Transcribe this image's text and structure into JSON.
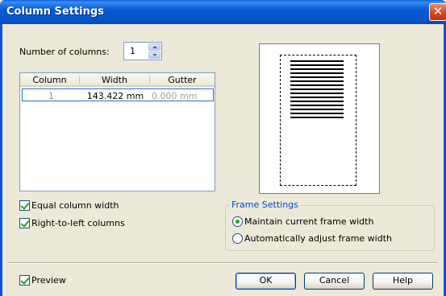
{
  "window": {
    "title": "Column Settings",
    "close_label": "✕"
  },
  "columns": {
    "label": "Number of columns:",
    "value": "1"
  },
  "table": {
    "headers": [
      "Column",
      "Width",
      "Gutter"
    ],
    "rows": [
      {
        "column": "1",
        "width": "143.422 mm",
        "gutter": "0.000 mm"
      }
    ]
  },
  "options": {
    "equal_width": {
      "label": "Equal column width",
      "checked": true
    },
    "rtl": {
      "label": "Right-to-left columns",
      "checked": true
    }
  },
  "frame_settings": {
    "title": "Frame Settings",
    "maintain": {
      "label": "Maintain current frame width",
      "selected": true
    },
    "adjust": {
      "label": "Automatically adjust frame width",
      "selected": false
    }
  },
  "footer": {
    "preview": {
      "label": "Preview",
      "checked": true
    },
    "ok_label": "OK",
    "cancel_label": "Cancel",
    "help_label": "Help"
  },
  "colors": {
    "titlebar": "#0453c8",
    "dialog_bg": "#ece9d8",
    "accent": "#316ac5"
  }
}
